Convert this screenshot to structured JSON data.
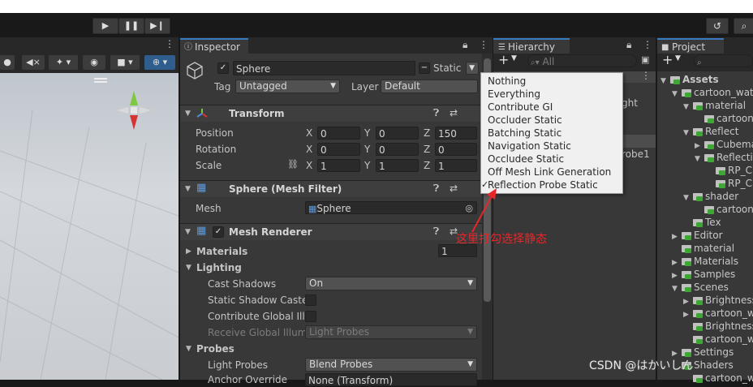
{
  "toolbar": {
    "play_icon": "play-icon",
    "pause_icon": "pause-icon",
    "step_icon": "step-icon",
    "history_icon": "history-icon",
    "search_icon": "search-icon"
  },
  "inspector": {
    "tab_label": "Inspector",
    "object": {
      "name": "Sphere",
      "static_label": "Static",
      "tag_label": "Tag",
      "tag_value": "Untagged",
      "layer_label": "Layer",
      "layer_value": "Default"
    },
    "transform": {
      "title": "Transform",
      "rows": [
        {
          "label": "Position",
          "x": "0",
          "y": "0",
          "z": "150"
        },
        {
          "label": "Rotation",
          "x": "0",
          "y": "0",
          "z": "0"
        },
        {
          "label": "Scale",
          "x": "1",
          "y": "1",
          "z": "1"
        }
      ],
      "axis_x": "X",
      "axis_y": "Y",
      "axis_z": "Z"
    },
    "mesh_filter": {
      "title": "Sphere (Mesh Filter)",
      "mesh_label": "Mesh",
      "mesh_value": "Sphere"
    },
    "mesh_renderer": {
      "title": "Mesh Renderer",
      "materials_label": "Materials",
      "materials_count": "1",
      "lighting_label": "Lighting",
      "cast_shadows_label": "Cast Shadows",
      "cast_shadows_value": "On",
      "static_shadow_label": "Static Shadow Caste",
      "contribute_gi_label": "Contribute Global Illu",
      "receive_gi_label": "Receive Global Illumi",
      "receive_gi_value": "Light Probes",
      "probes_label": "Probes",
      "light_probes_label": "Light Probes",
      "light_probes_value": "Blend Probes",
      "anchor_label": "Anchor Override",
      "anchor_value": "None (Transform)"
    }
  },
  "static_menu": {
    "items": [
      {
        "label": "Nothing",
        "checked": false
      },
      {
        "label": "Everything",
        "checked": false
      },
      {
        "label": "Contribute GI",
        "checked": false
      },
      {
        "label": "Occluder Static",
        "checked": false
      },
      {
        "label": "Batching Static",
        "checked": false
      },
      {
        "label": "Navigation Static",
        "checked": false
      },
      {
        "label": "Occludee Static",
        "checked": false
      },
      {
        "label": "Off Mesh Link Generation",
        "checked": false
      },
      {
        "label": "Reflection Probe Static",
        "checked": true
      }
    ],
    "check_mark": "✓"
  },
  "hierarchy": {
    "tab_label": "Hierarchy",
    "search_placeholder": "All",
    "add_label": "+",
    "partial_rows": [
      "ght",
      "robe1"
    ]
  },
  "project": {
    "tab_label": "Project",
    "add_label": "+",
    "tree": [
      {
        "label": "Assets",
        "indent": 0,
        "bold": true,
        "arrow": "▼"
      },
      {
        "label": "cartoon_wat",
        "indent": 1,
        "arrow": "▼"
      },
      {
        "label": "material",
        "indent": 2,
        "arrow": "▼"
      },
      {
        "label": "cartoon",
        "indent": 3,
        "arrow": ""
      },
      {
        "label": "Reflect",
        "indent": 2,
        "arrow": "▼"
      },
      {
        "label": "Cubema",
        "indent": 3,
        "arrow": "▶"
      },
      {
        "label": "Reflectio",
        "indent": 3,
        "arrow": "▼"
      },
      {
        "label": "RP_C",
        "indent": 4,
        "arrow": ""
      },
      {
        "label": "RP_C",
        "indent": 4,
        "arrow": ""
      },
      {
        "label": "shader",
        "indent": 2,
        "arrow": "▼"
      },
      {
        "label": "cartoon",
        "indent": 3,
        "arrow": ""
      },
      {
        "label": "Tex",
        "indent": 2,
        "arrow": ""
      },
      {
        "label": "Editor",
        "indent": 1,
        "arrow": "▶"
      },
      {
        "label": "material",
        "indent": 1,
        "arrow": ""
      },
      {
        "label": "Materials",
        "indent": 1,
        "arrow": "▶"
      },
      {
        "label": "Samples",
        "indent": 1,
        "arrow": "▶"
      },
      {
        "label": "Scenes",
        "indent": 1,
        "arrow": "▼"
      },
      {
        "label": "Brightness",
        "indent": 2,
        "arrow": "▶"
      },
      {
        "label": "cartoon_w",
        "indent": 2,
        "arrow": "▶"
      },
      {
        "label": "Brightness",
        "indent": 2,
        "arrow": ""
      },
      {
        "label": "cartoon_w",
        "indent": 2,
        "arrow": ""
      },
      {
        "label": "Settings",
        "indent": 1,
        "arrow": "▶"
      },
      {
        "label": "Shaders",
        "indent": 1,
        "arrow": ""
      },
      {
        "label": "cartoon_w",
        "indent": 2,
        "arrow": ""
      }
    ]
  },
  "annotation": {
    "text": "这里打勾选择静态",
    "color": "#e8262a"
  },
  "watermark": {
    "text": "CSDN @はかいしん"
  },
  "colors": {
    "accent": "#3a79bb",
    "panel": "#383838",
    "header": "#282828"
  }
}
